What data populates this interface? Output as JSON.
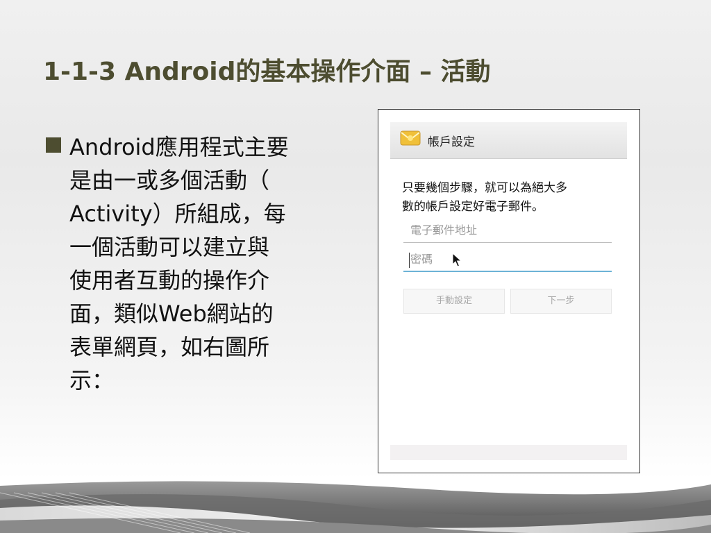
{
  "slide": {
    "title": "1-1-3 Android的基本操作介面 – 活動",
    "bullet_lines": [
      "Android應用程式主要",
      "是由一或多個活動（",
      "Activity）所組成，每",
      "一個活動可以建立與",
      "使用者互動的操作介",
      "面，類似Web網站的",
      "表單網頁，如右圖所",
      "示："
    ]
  },
  "phone": {
    "app_title": "帳戶設定",
    "intro_lines": [
      "只要幾個步驟，就可以為絕大多",
      "數的帳戶設定好電子郵件。"
    ],
    "email_placeholder": "電子郵件地址",
    "password_placeholder": "密碼",
    "manual_setup_label": "手動設定",
    "next_label": "下一步"
  },
  "colors": {
    "title": "#4d4d30",
    "bullet": "#4d4d30",
    "focus_underline": "#6cb3d6"
  }
}
